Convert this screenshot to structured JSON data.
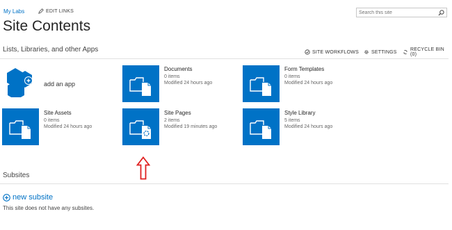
{
  "header": {
    "breadcrumb": "My Labs",
    "edit_links_label": "EDIT LINKS",
    "page_title": "Site Contents",
    "search": {
      "placeholder": "Search this site",
      "value": ""
    }
  },
  "lists_section": {
    "title": "Lists, Libraries, and other Apps",
    "toolbar": {
      "site_workflows": "SITE WORKFLOWS",
      "settings": "SETTINGS",
      "recycle_bin": "RECYCLE BIN (0)"
    }
  },
  "add_app": {
    "label": "add an app",
    "icon": "add-app-icon"
  },
  "apps": [
    {
      "title": "Documents",
      "items": "0 items",
      "modified": "Modified 24 hours ago",
      "icon": "folder-document-icon"
    },
    {
      "title": "Form Templates",
      "items": "0 items",
      "modified": "Modified 24 hours ago",
      "icon": "folder-document-icon"
    },
    {
      "title": "Site Assets",
      "items": "0 items",
      "modified": "Modified 24 hours ago",
      "icon": "folder-document-icon"
    },
    {
      "title": "Site Pages",
      "items": "2 items",
      "modified": "Modified 19 minutes ago",
      "icon": "folder-page-icon"
    },
    {
      "title": "Style Library",
      "items": "5 items",
      "modified": "Modified 24 hours ago",
      "icon": "folder-document-icon"
    }
  ],
  "subsites": {
    "title": "Subsites",
    "new_subsite_label": "new subsite",
    "empty_message": "This site does not have any subsites."
  },
  "annotation": {
    "icon": "red-up-arrow-icon",
    "color": "#e02020"
  },
  "colors": {
    "accent": "#0072c6",
    "tile": "#0072c6"
  }
}
